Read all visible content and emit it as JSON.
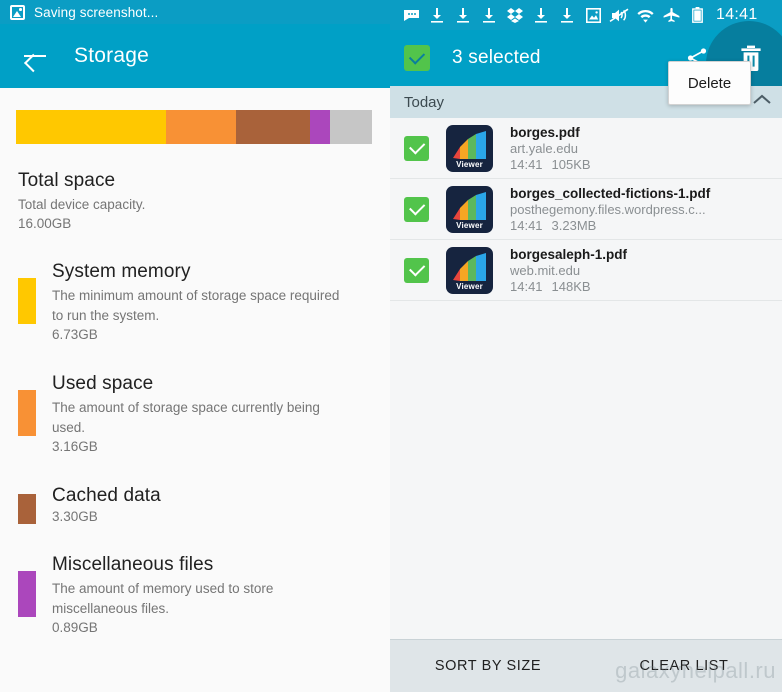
{
  "left_panel": {
    "notification": {
      "icon": "image-saving-icon",
      "text": "Saving screenshot..."
    },
    "appbar": {
      "back_icon": "back-arrow-icon",
      "title": "Storage"
    },
    "colors": {
      "appbar": "#00a0c6",
      "notification_bar": "#0b9dc4",
      "system_memory": "#ffc800",
      "used_space": "#f89135",
      "cached_data": "#a9623a",
      "miscellaneous": "#ab47bc",
      "free_space": "#c6c6c6"
    },
    "segment_bar": [
      {
        "name": "System memory",
        "color": "#ffc800",
        "percent": 42.1
      },
      {
        "name": "Used space",
        "color": "#f89135",
        "percent": 19.8
      },
      {
        "name": "Cached data",
        "color": "#a9623a",
        "percent": 20.6
      },
      {
        "name": "Miscellaneous files",
        "color": "#ab47bc",
        "percent": 5.6
      },
      {
        "name": "Free",
        "color": "#c6c6c6",
        "percent": 11.9
      }
    ],
    "total": {
      "title": "Total space",
      "description": "Total device capacity.",
      "value": "16.00GB"
    },
    "items": [
      {
        "title": "System memory",
        "description": "The minimum amount of storage space required to run the system.",
        "value": "6.73GB",
        "color": "#ffc800"
      },
      {
        "title": "Used space",
        "description": "The amount of storage space currently being used.",
        "value": "3.16GB",
        "color": "#f89135"
      },
      {
        "title": "Cached data",
        "description": "",
        "value": "3.30GB",
        "color": "#a9623a"
      },
      {
        "title": "Miscellaneous files",
        "description": "The amount of memory used to store miscellaneous files.",
        "value": "0.89GB",
        "color": "#ab47bc"
      }
    ]
  },
  "right_panel": {
    "status_bar": {
      "icons": [
        "message-icon",
        "download-icon",
        "download-icon",
        "download-icon",
        "dropbox-icon",
        "download-icon",
        "download-icon",
        "image-icon",
        "mute-vibrate-icon",
        "wifi-icon",
        "airplane-mode-icon",
        "battery-icon"
      ],
      "time": "14:41"
    },
    "appbar": {
      "select_all_checkbox": "checkbox-checked-icon",
      "title": "3 selected",
      "share_icon": "share-icon",
      "delete_icon": "trash-icon",
      "accent": "#00a0c6"
    },
    "tooltip": {
      "label": "Delete"
    },
    "section": {
      "label": "Today",
      "collapse_icon": "chevron-up-icon"
    },
    "files": [
      {
        "checked": true,
        "icon": "pdf-viewer-icon",
        "icon_label": "Viewer",
        "name": "borges.pdf",
        "source": "art.yale.edu",
        "time": "14:41",
        "size": "105KB"
      },
      {
        "checked": true,
        "icon": "pdf-viewer-icon",
        "icon_label": "Viewer",
        "name": "borges_collected-fictions-1.pdf",
        "source": "posthegemony.files.wordpress.c...",
        "time": "14:41",
        "size": "3.23MB"
      },
      {
        "checked": true,
        "icon": "pdf-viewer-icon",
        "icon_label": "Viewer",
        "name": "borgesaleph-1.pdf",
        "source": "web.mit.edu",
        "time": "14:41",
        "size": "148KB"
      }
    ],
    "bottom_bar": {
      "sort_label": "SORT BY SIZE",
      "clear_label": "CLEAR LIST"
    },
    "watermark": "galaxyhelpall.ru"
  }
}
